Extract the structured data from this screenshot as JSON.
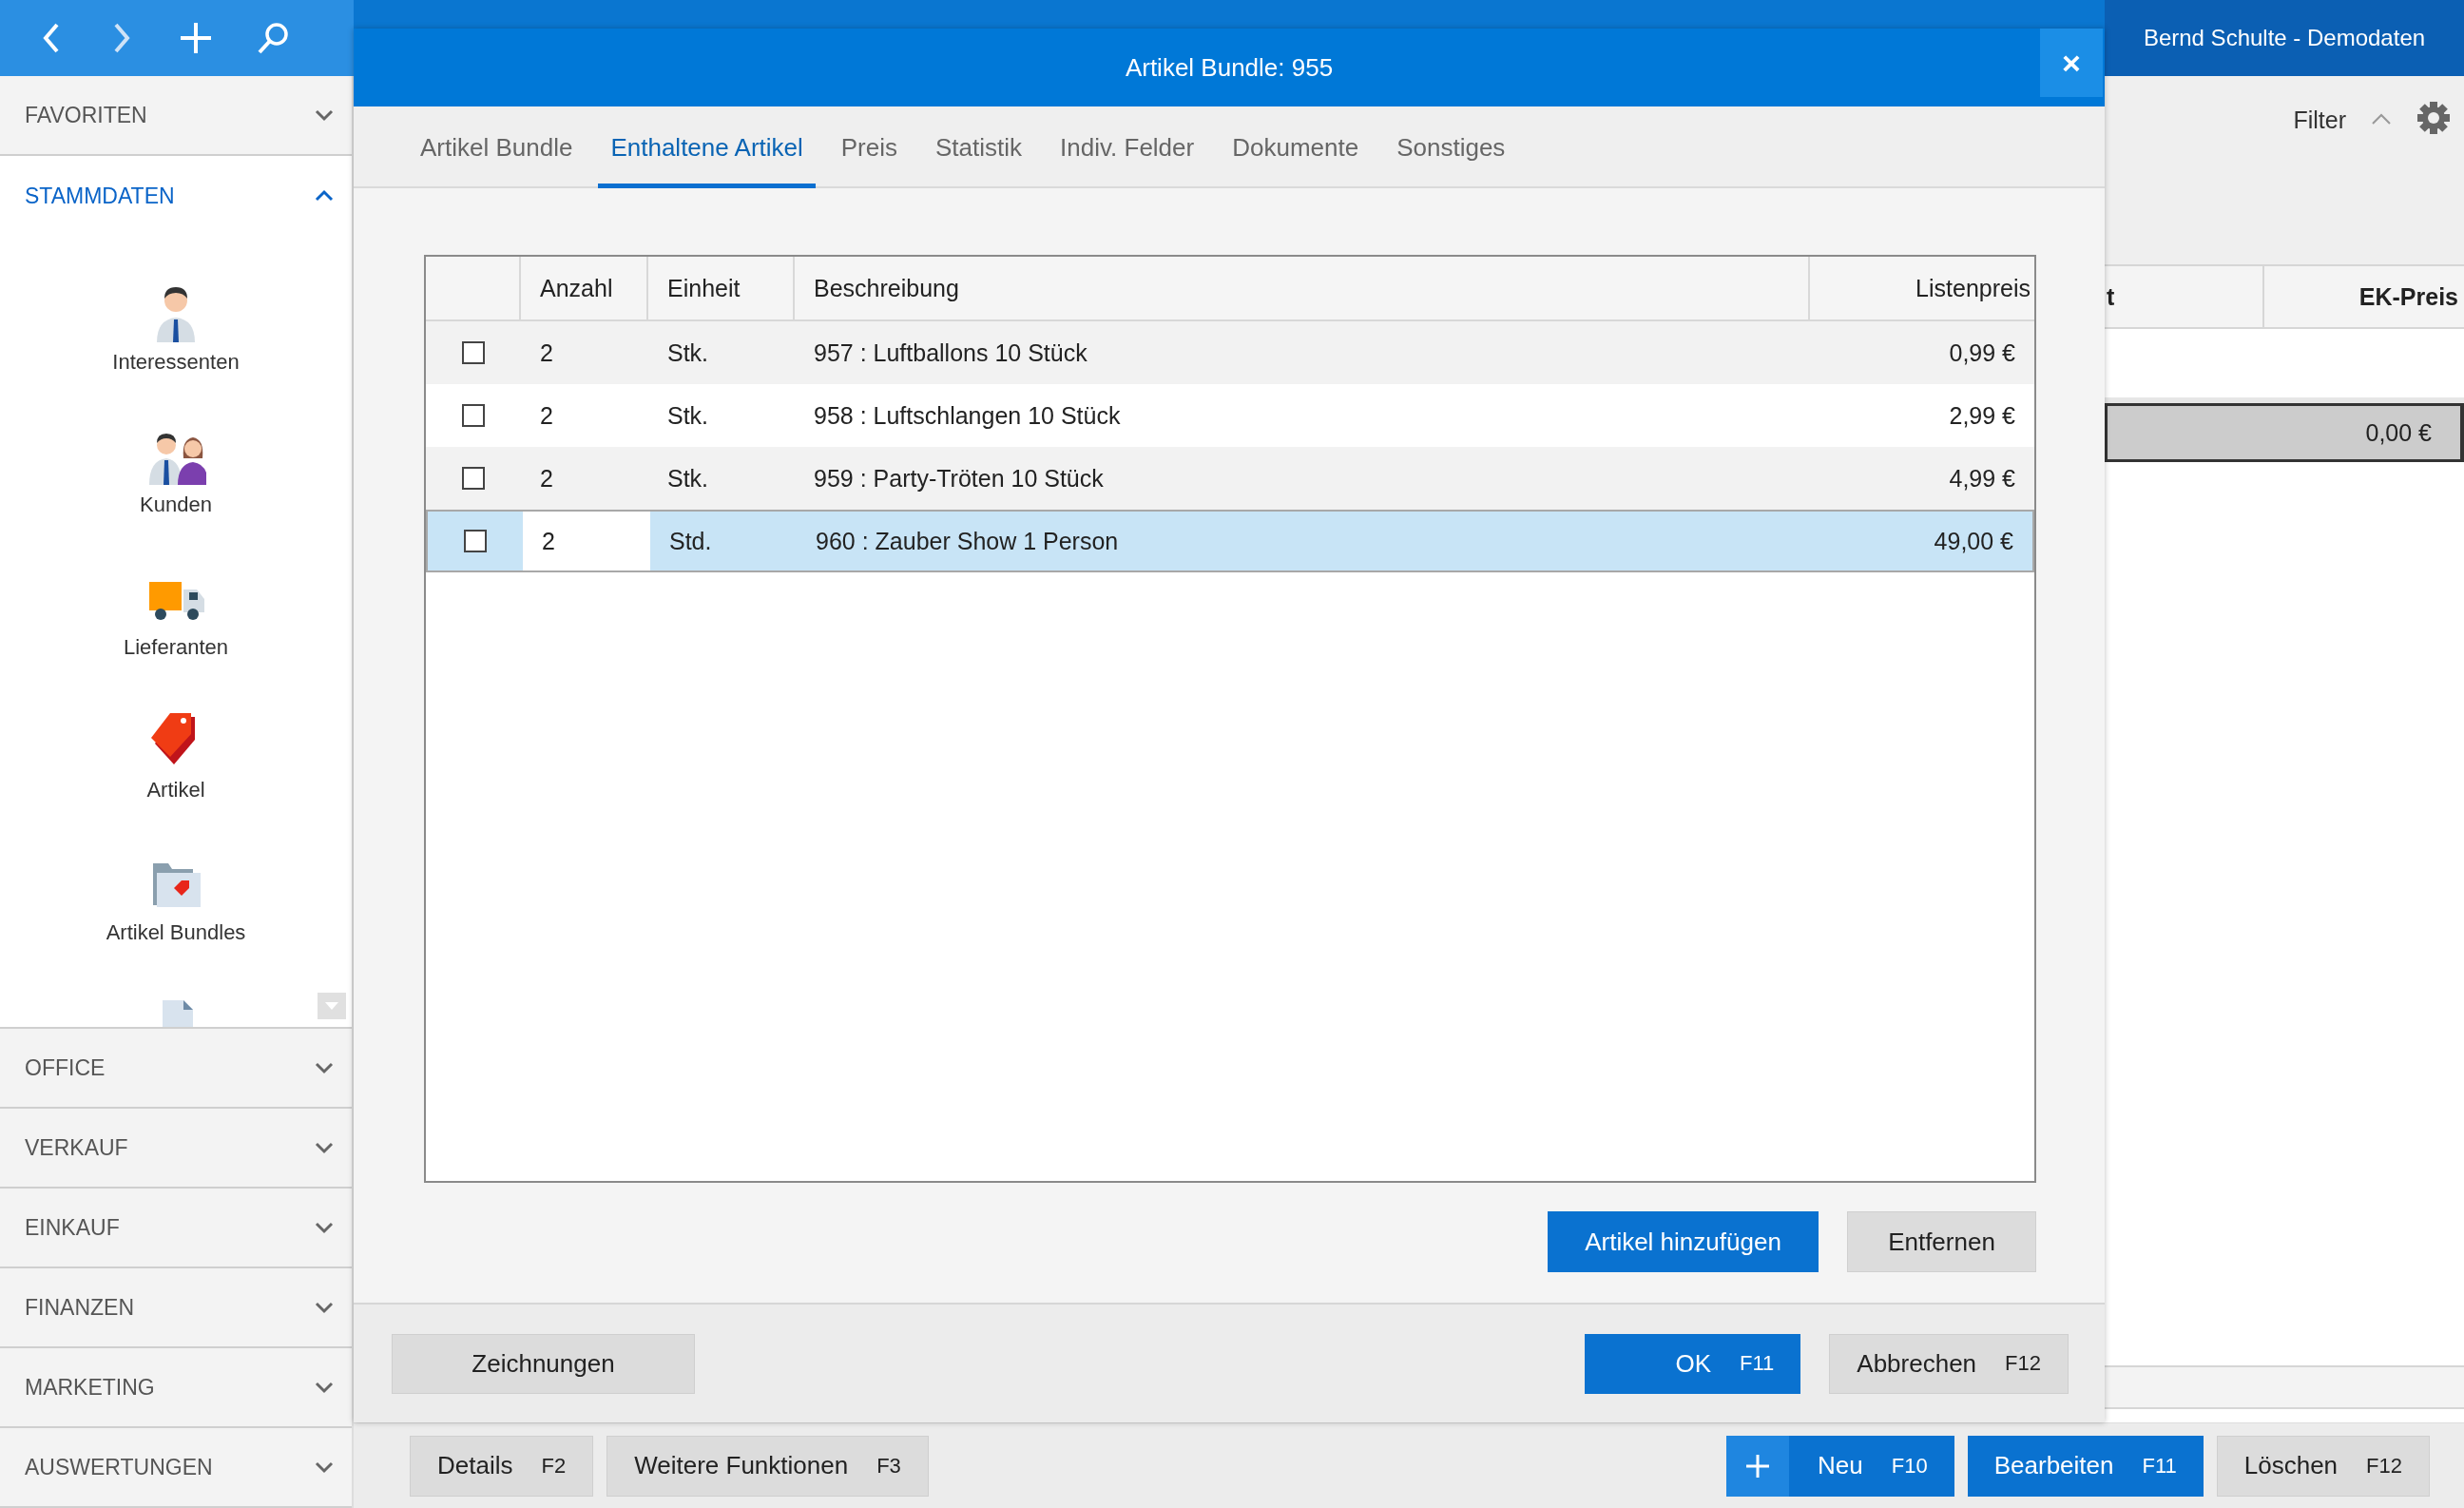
{
  "user": "Bernd Schulte - Demodaten",
  "sidebar": {
    "sections": [
      {
        "label": "FAVORITEN",
        "expanded": false
      },
      {
        "label": "STAMMDATEN",
        "expanded": true,
        "items": [
          {
            "label": "Interessenten",
            "kind": "person"
          },
          {
            "label": "Kunden",
            "kind": "people"
          },
          {
            "label": "Lieferanten",
            "kind": "truck"
          },
          {
            "label": "Artikel",
            "kind": "tag"
          },
          {
            "label": "Artikel Bundles",
            "kind": "folder"
          },
          {
            "kind": "document"
          }
        ]
      },
      {
        "label": "OFFICE",
        "expanded": false
      },
      {
        "label": "VERKAUF",
        "expanded": false
      },
      {
        "label": "EINKAUF",
        "expanded": false
      },
      {
        "label": "FINANZEN",
        "expanded": false
      },
      {
        "label": "MARKETING",
        "expanded": false
      },
      {
        "label": "AUSWERTUNGEN",
        "expanded": false
      }
    ]
  },
  "main": {
    "filter_label": "Filter",
    "columns": [
      "t",
      "EK-Preis"
    ],
    "total": "0,00 €"
  },
  "dialog": {
    "title": "Artikel Bundle: 955",
    "close": "×",
    "tabs": [
      {
        "label": "Artikel Bundle",
        "selected": false
      },
      {
        "label": "Enthaltene Artikel",
        "selected": true
      },
      {
        "label": "Preis",
        "selected": false
      },
      {
        "label": "Statistik",
        "selected": false
      },
      {
        "label": "Indiv. Felder",
        "selected": false
      },
      {
        "label": "Dokumente",
        "selected": false
      },
      {
        "label": "Sonstiges",
        "selected": false
      }
    ],
    "table": {
      "columns": [
        "Anzahl",
        "Einheit",
        "Beschreibung",
        "Listenpreis"
      ],
      "rows": [
        {
          "checked": false,
          "selected": false,
          "cells": [
            "2",
            "Stk.",
            "957 : Luftballons 10 Stück",
            "0,99 €"
          ]
        },
        {
          "checked": false,
          "selected": false,
          "cells": [
            "2",
            "Stk.",
            "958 : Luftschlangen 10 Stück",
            "2,99 €"
          ]
        },
        {
          "checked": false,
          "selected": false,
          "cells": [
            "2",
            "Stk.",
            "959 : Party-Tröten 10 Stück",
            "4,99 €"
          ]
        },
        {
          "checked": false,
          "selected": true,
          "cells": [
            "2",
            "Std.",
            "960 : Zauber Show 1 Person",
            "49,00 €"
          ]
        }
      ]
    },
    "actions": [
      {
        "label": "Artikel hinzufügen",
        "kind": "primary"
      },
      {
        "label": "Entfernen",
        "kind": "default"
      }
    ],
    "footer_left": [
      {
        "label": "Zeichnungen",
        "kind": "default"
      }
    ],
    "footer_right": [
      {
        "label": "OK",
        "shortcut": "F11",
        "kind": "primary"
      },
      {
        "label": "Abbrechen",
        "shortcut": "F12",
        "kind": "default"
      }
    ]
  },
  "bottom_bar": {
    "left": [
      {
        "label": "Details",
        "shortcut": "F2",
        "kind": "default"
      },
      {
        "label": "Weitere Funktionen",
        "shortcut": "F3",
        "kind": "default"
      }
    ],
    "right": [
      {
        "label": "Neu",
        "shortcut": "F10",
        "kind": "primary_add"
      },
      {
        "label": "Bearbeiten",
        "shortcut": "F11",
        "kind": "primary"
      },
      {
        "label": "Löschen",
        "shortcut": "F12",
        "kind": "default"
      }
    ]
  }
}
